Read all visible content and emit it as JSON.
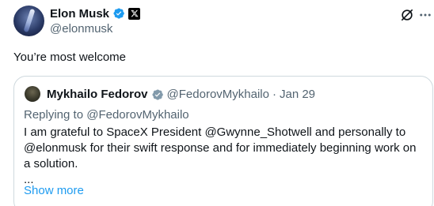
{
  "author": {
    "name": "Elon Musk",
    "handle": "@elonmusk",
    "verified_color": "#1d9bf0",
    "affiliation_icon": "x-logo-icon"
  },
  "tweet": {
    "text": "You’re most welcome"
  },
  "quote": {
    "name": "Mykhailo Fedorov",
    "handle": "@FedorovMykhailo",
    "separator": "·",
    "date": "Jan 29",
    "badge_color": "#829aab",
    "replying_to": "Replying to @FedorovMykhailo",
    "body": "I am grateful to SpaceX President @Gwynne_Shotwell and personally to @elonmusk for their swift response and for immediately beginning work on a solution.",
    "ellipsis": "...",
    "show_more": "Show more"
  },
  "colors": {
    "link": "#1d9bf0",
    "muted": "#536471",
    "border": "#cfd9de"
  }
}
